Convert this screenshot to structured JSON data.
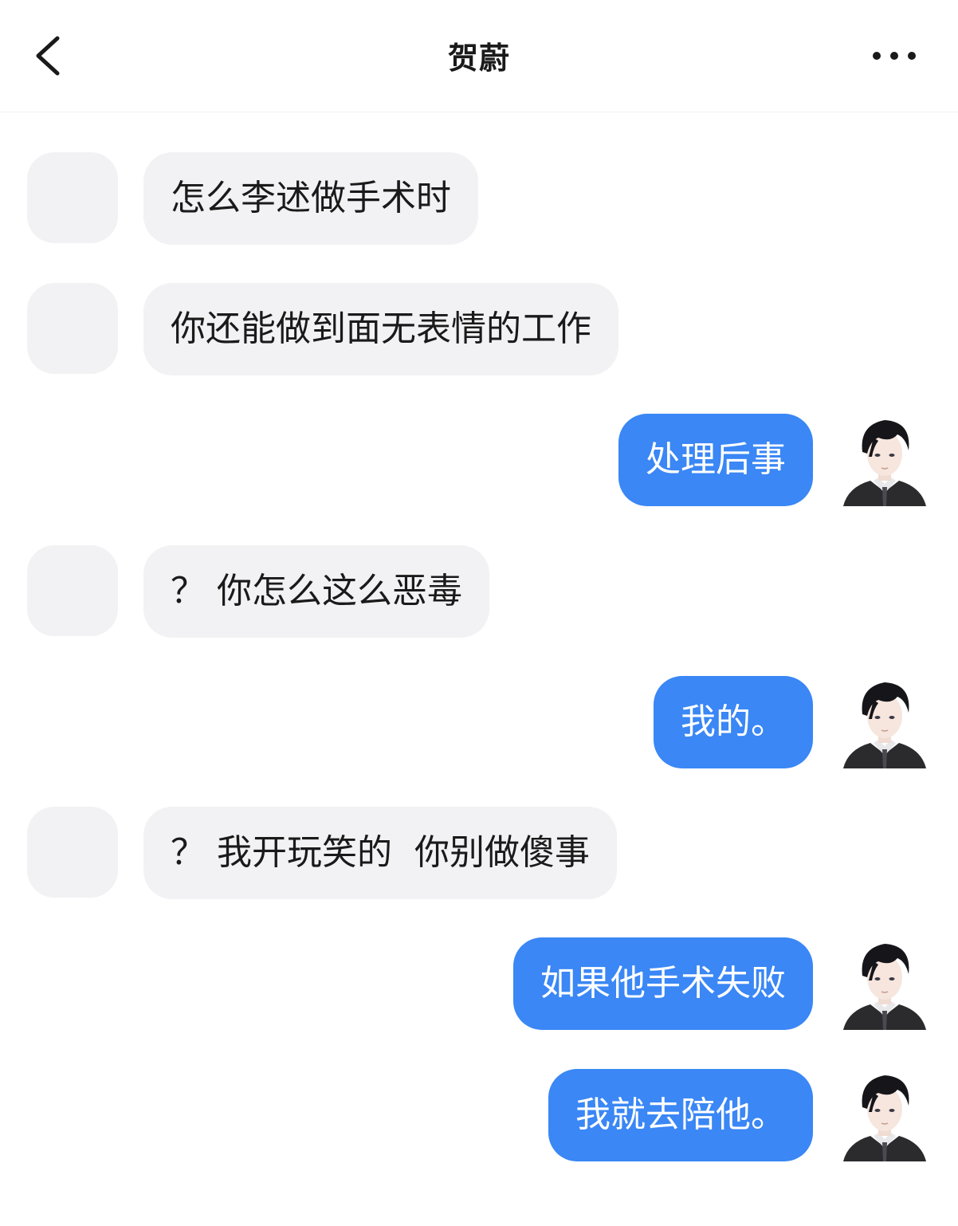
{
  "header": {
    "title": "贺蔚",
    "back_icon": "chevron-left-icon",
    "more_icon": "more-horizontal-icon"
  },
  "colors": {
    "outgoing_bubble": "#3a87f5",
    "incoming_bubble": "#f2f2f4",
    "background": "#ffffff"
  },
  "messages": [
    {
      "side": "incoming",
      "text": "怎么李述做手术时"
    },
    {
      "side": "incoming",
      "text": "你还能做到面无表情的工作"
    },
    {
      "side": "outgoing",
      "text": "处理后事"
    },
    {
      "side": "incoming",
      "text": "？ 你怎么这么恶毒"
    },
    {
      "side": "outgoing",
      "text": "我的。"
    },
    {
      "side": "incoming",
      "text": "？ 我开玩笑的  你别做傻事"
    },
    {
      "side": "outgoing",
      "text": "如果他手术失败"
    },
    {
      "side": "outgoing",
      "text": "我就去陪他。"
    }
  ]
}
